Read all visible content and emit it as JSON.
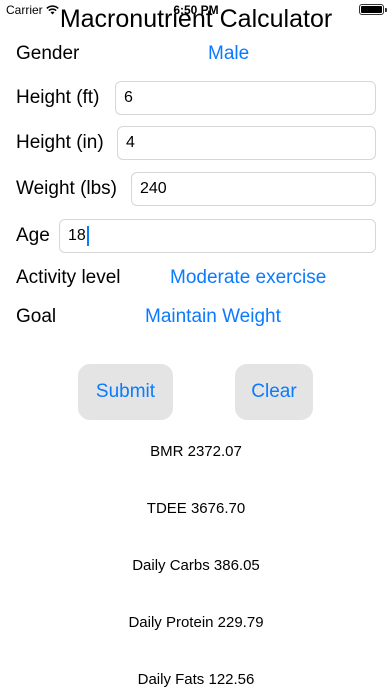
{
  "status": {
    "carrier": "Carrier",
    "time": "6:50 PM"
  },
  "title": "Macronutrient Calculator",
  "form": {
    "gender_label": "Gender",
    "gender_value": "Male",
    "height_ft_label": "Height (ft)",
    "height_ft_value": "6",
    "height_in_label": "Height (in)",
    "height_in_value": "4",
    "weight_label": "Weight (lbs)",
    "weight_value": "240",
    "age_label": "Age",
    "age_value": "18",
    "activity_label": "Activity level",
    "activity_value": "Moderate exercise",
    "goal_label": "Goal",
    "goal_value": "Maintain Weight"
  },
  "buttons": {
    "submit": "Submit",
    "clear": "Clear"
  },
  "results": {
    "bmr": "BMR 2372.07",
    "tdee": "TDEE 3676.70",
    "carbs": "Daily Carbs 386.05",
    "protein": "Daily Protein 229.79",
    "fats": "Daily Fats 122.56"
  },
  "colors": {
    "accent": "#0a7aff",
    "button_bg": "#e4e4e4",
    "input_border": "#d6d6d6"
  },
  "icons": {
    "wifi": "wifi-icon",
    "battery": "battery-icon"
  }
}
